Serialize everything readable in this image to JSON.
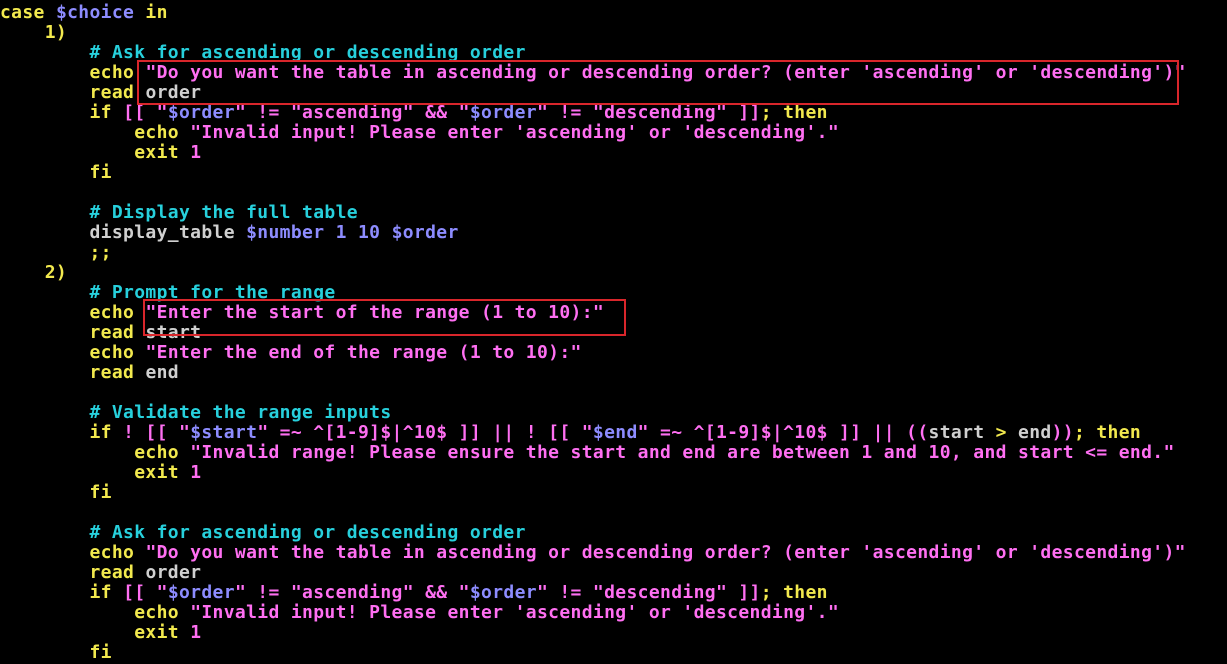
{
  "colors": {
    "background": "#000000",
    "keyword": "#f2e94e",
    "variable": "#8d8cff",
    "string": "#ff6ff2",
    "comment": "#27d0dc",
    "number": "#ff6ff2",
    "plain": "#d0d0d0",
    "highlight_box": "#d9262b"
  },
  "code_lines": [
    [
      {
        "t": "case ",
        "c": "keyword"
      },
      {
        "t": "$choice",
        "c": "variable"
      },
      {
        "t": " in",
        "c": "keyword"
      }
    ],
    [
      {
        "t": "    1)",
        "c": "keyword"
      }
    ],
    [
      {
        "t": "        # Ask for ascending or descending order",
        "c": "comment"
      }
    ],
    [
      {
        "t": "        echo ",
        "c": "keyword"
      },
      {
        "t": "\"Do you want the table in ascending or descending order? (enter 'ascending' or 'descending')\"",
        "c": "string"
      }
    ],
    [
      {
        "t": "        read ",
        "c": "keyword"
      },
      {
        "t": "order",
        "c": "plain"
      }
    ],
    [
      {
        "t": "        if ",
        "c": "keyword"
      },
      {
        "t": "[[ ",
        "c": "string"
      },
      {
        "t": "\"",
        "c": "string"
      },
      {
        "t": "$order",
        "c": "variable"
      },
      {
        "t": "\" != \"ascending\" && \"",
        "c": "string"
      },
      {
        "t": "$order",
        "c": "variable"
      },
      {
        "t": "\" != \"descending\" ]]",
        "c": "string"
      },
      {
        "t": "; then",
        "c": "keyword"
      }
    ],
    [
      {
        "t": "            echo ",
        "c": "keyword"
      },
      {
        "t": "\"Invalid input! Please enter 'ascending' or 'descending'.\"",
        "c": "string"
      }
    ],
    [
      {
        "t": "            exit ",
        "c": "keyword"
      },
      {
        "t": "1",
        "c": "number"
      }
    ],
    [
      {
        "t": "        fi",
        "c": "keyword"
      }
    ],
    [
      {
        "t": "",
        "c": "plain"
      }
    ],
    [
      {
        "t": "        # Display the full table",
        "c": "comment"
      }
    ],
    [
      {
        "t": "        display_table ",
        "c": "plain"
      },
      {
        "t": "$number",
        "c": "variable"
      },
      {
        "t": " 1 10 ",
        "c": "variable"
      },
      {
        "t": "$order",
        "c": "variable"
      }
    ],
    [
      {
        "t": "        ;;",
        "c": "keyword"
      }
    ],
    [
      {
        "t": "    2)",
        "c": "keyword"
      }
    ],
    [
      {
        "t": "        # Prompt for the range",
        "c": "comment"
      }
    ],
    [
      {
        "t": "        echo ",
        "c": "keyword"
      },
      {
        "t": "\"Enter the start of the range (1 to 10):\"",
        "c": "string"
      }
    ],
    [
      {
        "t": "        read ",
        "c": "keyword"
      },
      {
        "t": "start",
        "c": "plain"
      }
    ],
    [
      {
        "t": "        echo ",
        "c": "keyword"
      },
      {
        "t": "\"Enter the end of the range (1 to 10):\"",
        "c": "string"
      }
    ],
    [
      {
        "t": "        read ",
        "c": "keyword"
      },
      {
        "t": "end",
        "c": "plain"
      }
    ],
    [
      {
        "t": "",
        "c": "plain"
      }
    ],
    [
      {
        "t": "        # Validate the range inputs",
        "c": "comment"
      }
    ],
    [
      {
        "t": "        if ",
        "c": "keyword"
      },
      {
        "t": "! [[ \"",
        "c": "string"
      },
      {
        "t": "$start",
        "c": "variable"
      },
      {
        "t": "\" =~ ^[1-9]$|^10$ ]] || ! [[ \"",
        "c": "string"
      },
      {
        "t": "$end",
        "c": "variable"
      },
      {
        "t": "\" =~ ^[1-9]$|^10$ ]] || ((",
        "c": "string"
      },
      {
        "t": "start ",
        "c": "plain"
      },
      {
        "t": ">",
        "c": "keyword"
      },
      {
        "t": " end",
        "c": "plain"
      },
      {
        "t": "))",
        "c": "string"
      },
      {
        "t": "; then",
        "c": "keyword"
      }
    ],
    [
      {
        "t": "            echo ",
        "c": "keyword"
      },
      {
        "t": "\"Invalid range! Please ensure the start and end are between 1 and 10, and start <= end.\"",
        "c": "string"
      }
    ],
    [
      {
        "t": "            exit ",
        "c": "keyword"
      },
      {
        "t": "1",
        "c": "number"
      }
    ],
    [
      {
        "t": "        fi",
        "c": "keyword"
      }
    ],
    [
      {
        "t": "",
        "c": "plain"
      }
    ],
    [
      {
        "t": "        # Ask for ascending or descending order",
        "c": "comment"
      }
    ],
    [
      {
        "t": "        echo ",
        "c": "keyword"
      },
      {
        "t": "\"Do you want the table in ascending or descending order? (enter 'ascending' or 'descending')\"",
        "c": "string"
      }
    ],
    [
      {
        "t": "        read ",
        "c": "keyword"
      },
      {
        "t": "order",
        "c": "plain"
      }
    ],
    [
      {
        "t": "        if ",
        "c": "keyword"
      },
      {
        "t": "[[ ",
        "c": "string"
      },
      {
        "t": "\"",
        "c": "string"
      },
      {
        "t": "$order",
        "c": "variable"
      },
      {
        "t": "\" != \"ascending\" && \"",
        "c": "string"
      },
      {
        "t": "$order",
        "c": "variable"
      },
      {
        "t": "\" != \"descending\" ]]",
        "c": "string"
      },
      {
        "t": "; then",
        "c": "keyword"
      }
    ],
    [
      {
        "t": "            echo ",
        "c": "keyword"
      },
      {
        "t": "\"Invalid input! Please enter 'ascending' or 'descending'.\"",
        "c": "string"
      }
    ],
    [
      {
        "t": "            exit ",
        "c": "keyword"
      },
      {
        "t": "1",
        "c": "number"
      }
    ],
    [
      {
        "t": "        fi",
        "c": "keyword"
      }
    ]
  ]
}
